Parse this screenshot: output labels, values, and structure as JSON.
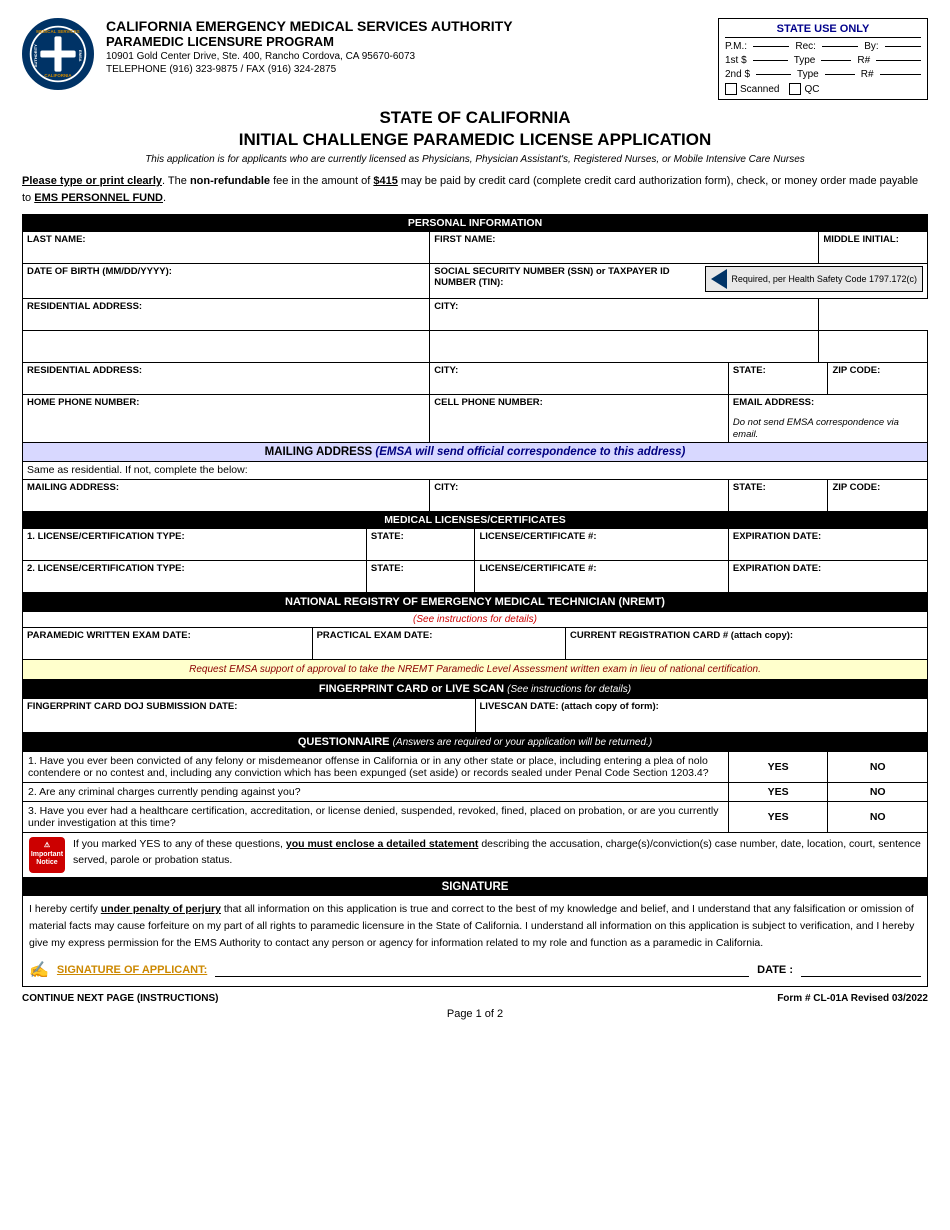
{
  "header": {
    "logo_text": "MEDICAL SERVICES\nEMSA\nAUTHORITY\nCALIFORNIA",
    "agency_name": "CALIFORNIA EMERGENCY MEDICAL SERVICES AUTHORITY",
    "program_name": "PARAMEDIC LICENSURE PROGRAM",
    "address": "10901 Gold Center Drive, Ste. 400, Rancho Cordova, CA  95670-6073",
    "telephone": "TELEPHONE (916) 323-9875 / FAX (916) 324-2875"
  },
  "state_use": {
    "title": "STATE USE ONLY",
    "pm_label": "P.M.:",
    "rec_label": "Rec:",
    "by_label": "By:",
    "first_dollar_label": "1st $",
    "type_label1": "Type",
    "r_hash1": "R#",
    "second_dollar_label": "2nd $",
    "type_label2": "Type",
    "r_hash2": "R#",
    "scanned_label": "Scanned",
    "qc_label": "QC"
  },
  "title": {
    "line1": "STATE OF CALIFORNIA",
    "line2": "INITIAL CHALLENGE PARAMEDIC LICENSE APPLICATION",
    "italics": "This application is for applicants who are currently licensed as Physicians, Physician Assistant's, Registered Nurses, or Mobile Intensive Care Nurses"
  },
  "fee_note": {
    "text_parts": {
      "before_bold": "Please type or print clearly",
      "middle": ". The ",
      "non_refundable": "non-refundable",
      "fee_text": " fee in the amount of ",
      "amount": "$415",
      "rest": " may be paid by credit card (complete credit card authorization form), check, or money order made payable to ",
      "fund": "EMS PERSONNEL FUND",
      "period": "."
    }
  },
  "personal_info": {
    "section_title": "PERSONAL INFORMATION",
    "last_name_label": "LAST NAME:",
    "first_name_label": "FIRST NAME:",
    "middle_initial_label": "MIDDLE INITIAL:",
    "dob_label": "DATE OF BIRTH (MM/DD/YYYY):",
    "ssn_label": "SOCIAL SECURITY NUMBER (SSN) or TAXPAYER ID NUMBER (TIN):",
    "required_note": "Required, per Health Safety Code 1797.172(c)",
    "address_label": "RESIDENTIAL ADDRESS:",
    "city_label": "CITY:",
    "state_label": "STATE:",
    "zip_label": "ZIP CODE:",
    "home_phone_label": "HOME PHONE NUMBER:",
    "cell_phone_label": "CELL PHONE NUMBER:",
    "email_label": "EMAIL ADDRESS:",
    "email_note": "Do not send EMSA correspondence via email."
  },
  "mailing_address": {
    "section_title": "MAILING ADDRESS",
    "section_subtitle": "(EMSA will send official correspondence to this address)",
    "same_as_label": "Same as residential.  If not, complete the below:",
    "address_label": "MAILING ADDRESS:",
    "city_label": "CITY:",
    "state_label": "STATE:",
    "zip_label": "ZIP CODE:"
  },
  "medical_licenses": {
    "section_title": "MEDICAL LICENSES/CERTIFICATES",
    "row1": {
      "num": "1.",
      "type_label": "LICENSE/CERTIFICATION TYPE:",
      "state_label": "STATE:",
      "cert_num_label": "LICENSE/CERTIFICATE #:",
      "exp_label": "EXPIRATION DATE:"
    },
    "row2": {
      "num": "2.",
      "type_label": "LICENSE/CERTIFICATION TYPE:",
      "state_label": "STATE:",
      "cert_num_label": "LICENSE/CERTIFICATE #:",
      "exp_label": "EXPIRATION DATE:"
    }
  },
  "nremt": {
    "section_title": "NATIONAL REGISTRY OF EMERGENCY MEDICAL TECHNICIAN (NREMT)",
    "subtitle": "(See instructions for details)",
    "written_exam_label": "PARAMEDIC WRITTEN EXAM DATE:",
    "practical_exam_label": "PRACTICAL EXAM DATE:",
    "reg_card_label": "CURRENT REGISTRATION CARD # (attach copy):",
    "note": "Request EMSA support of approval to take the NREMT Paramedic Level Assessment written exam in lieu of national certification."
  },
  "fingerprint": {
    "section_title": "FINGERPRINT CARD  or  LIVE SCAN",
    "section_subtitle": "(See instructions for details)",
    "doj_label": "FINGERPRINT CARD DOJ SUBMISSION DATE:",
    "livescan_label": "LIVESCAN DATE: (attach copy of form):"
  },
  "questionnaire": {
    "section_title": "QUESTIONNAIRE",
    "section_note": "(Answers are required or your application will be returned.)",
    "q1": "1.  Have you ever been convicted of any felony or misdemeanor offense in California or in any other state or place, including entering a plea of nolo contendere or no contest and, including any conviction which has been expunged (set aside) or records sealed under Penal Code Section 1203.4?",
    "q2": "2.  Are any criminal charges currently pending against you?",
    "q3": "3.  Have you ever had a healthcare certification, accreditation, or license denied, suspended, revoked, fined, placed on probation, or are you currently under investigation at this time?",
    "yes_label": "YES",
    "no_label": "NO",
    "notice_text_before": "If you marked YES to any of these questions, ",
    "notice_bold": "you must enclose a detailed statement",
    "notice_after": " describing the accusation, charge(s)/conviction(s) case number, date, location, court, sentence served, parole or probation status.",
    "notice_icon_text": "Important\nNotice"
  },
  "signature": {
    "section_title": "SIGNATURE",
    "text": "I hereby certify under penalty of perjury that all information on this application is true and correct to the best of my knowledge and belief, and I understand that any falsification or omission of material facts may cause forfeiture on my part of all rights to paramedic licensure in the State of California.  I understand all information on this application is subject to verification, and I hereby give my express permission for the EMS Authority to contact any person or agency for information related to my role and function as a paramedic in California.",
    "sig_label": "SIGNATURE OF APPLICANT:",
    "date_label": "DATE :"
  },
  "footer": {
    "continue_text": "CONTINUE NEXT PAGE (INSTRUCTIONS)",
    "form_number": "Form # CL-01A Revised 03/2022",
    "page_text": "Page 1 of 2"
  }
}
